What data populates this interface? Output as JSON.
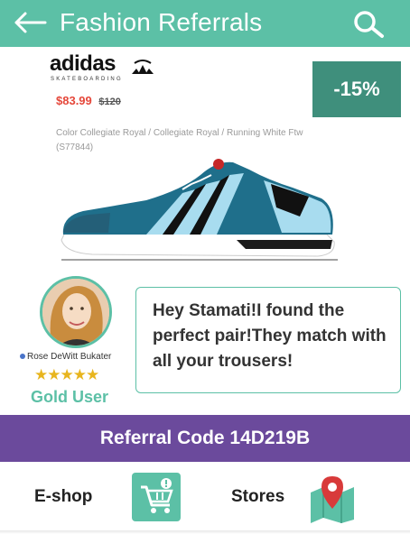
{
  "header": {
    "title": "Fashion Referrals",
    "back_icon": "back-arrow-icon",
    "search_icon": "search-icon",
    "color": "#5cc0a6"
  },
  "product": {
    "brand": "adidas",
    "brand_sub": "SKATEBOARDING",
    "price_now": "$83.99",
    "price_old": "$120",
    "color_desc": "Color Collegiate Royal / Collegiate Royal / Running White Ftw (S77844)",
    "discount": "-15%",
    "discount_color": "#3f8f7c"
  },
  "user": {
    "name": "Rose DeWitt Bukater",
    "rating": 4.5,
    "rating_max": 5,
    "stars_text": "★★★★★",
    "tier": "Gold User"
  },
  "message": {
    "text": "Hey Stamati!I found the perfect pair!They match with all your trousers!"
  },
  "referral": {
    "label": "Referral Code 14D219B",
    "color": "#6b4a9c"
  },
  "bottom_nav": {
    "eshop_label": "E-shop",
    "eshop_icon": "shopping-cart-icon",
    "stores_label": "Stores",
    "stores_icon": "map-pin-icon"
  }
}
